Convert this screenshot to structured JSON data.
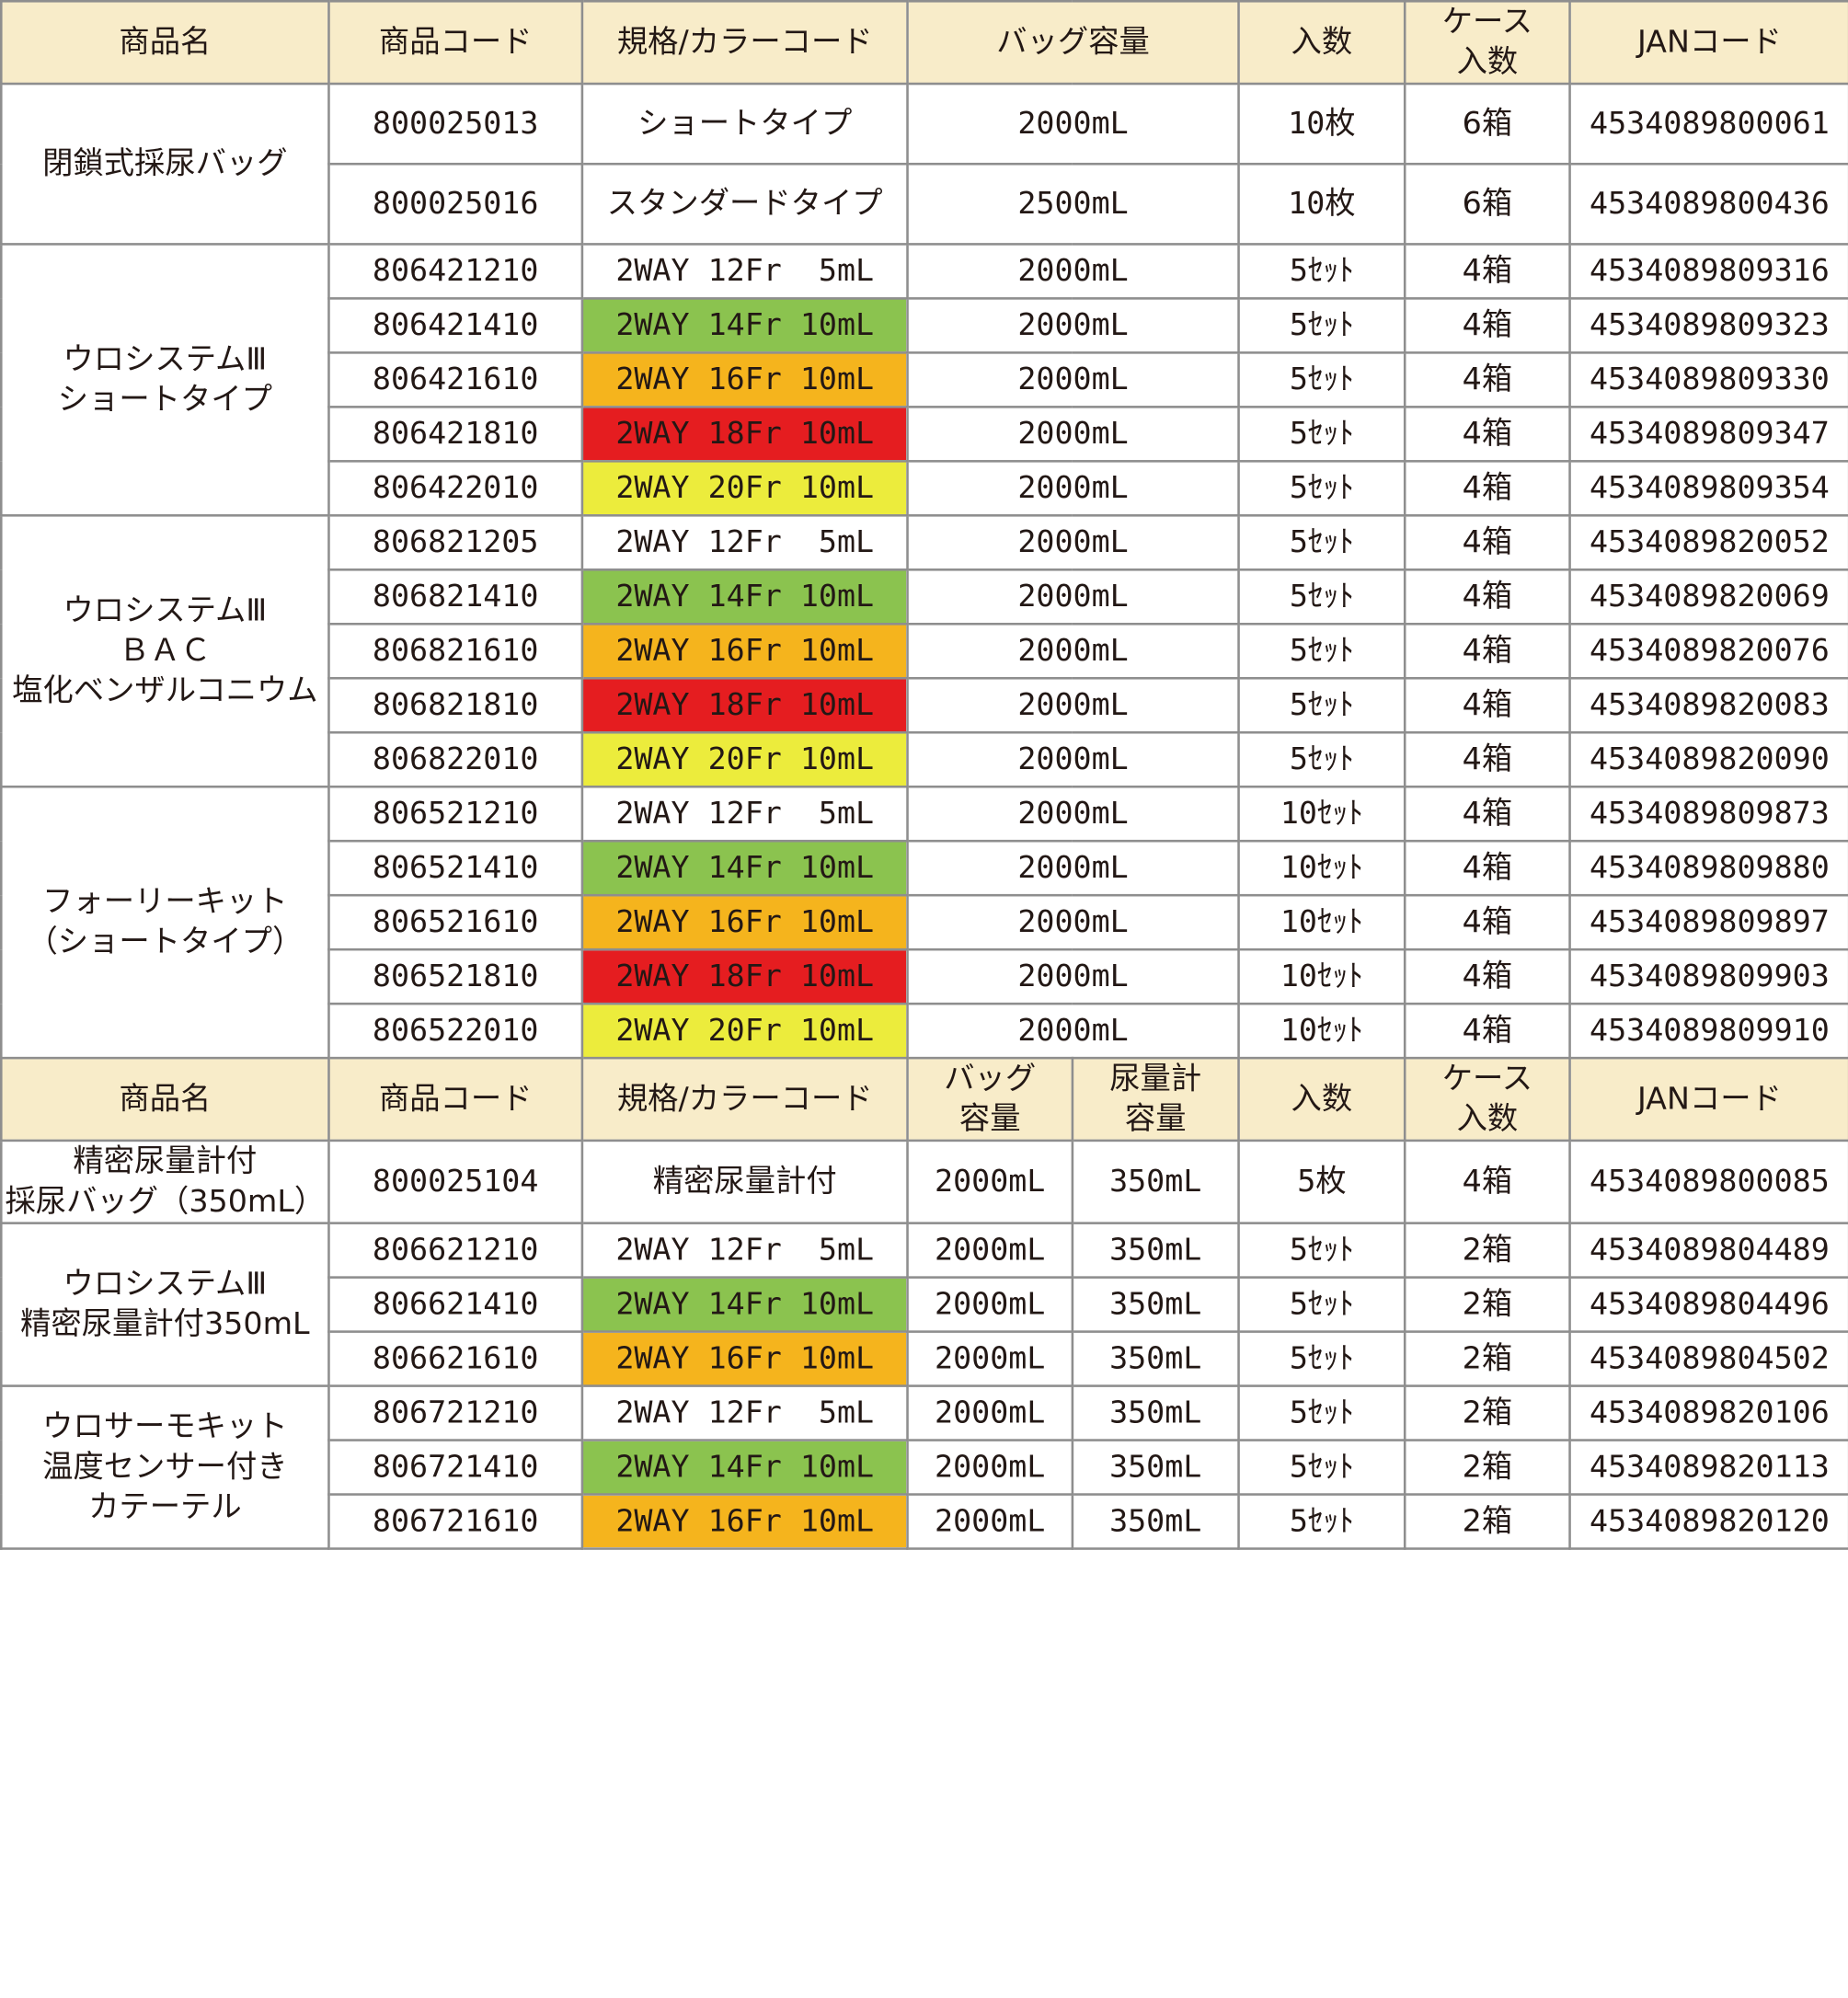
{
  "header1": {
    "name": "商品名",
    "code": "商品コード",
    "spec": "規格/カラーコード",
    "capacity": "バッグ容量",
    "qty": "入数",
    "case_line1": "ケース",
    "case_line2": "入数",
    "jan": "JANコード"
  },
  "header2": {
    "name": "商品名",
    "code": "商品コード",
    "spec": "規格/カラーコード",
    "bag_line1": "バッグ",
    "bag_line2": "容量",
    "meter_line1": "尿量計",
    "meter_line2": "容量",
    "qty": "入数",
    "case_line1": "ケース",
    "case_line2": "入数",
    "jan": "JANコード"
  },
  "colors": {
    "header_bg": "#f8ecc9",
    "14Fr": "#8bc34f",
    "16Fr": "#f5b41d",
    "18Fr": "#e51d20",
    "20Fr": "#ecec3c"
  },
  "groups": [
    {
      "name_lines": [
        "閉鎖式採尿バッグ"
      ],
      "rows": [
        {
          "code": "800025013",
          "spec": "ショートタイプ",
          "capacity": "2000mL",
          "qty": "10枚",
          "case": "6箱",
          "jan": "4534089800061"
        },
        {
          "code": "800025016",
          "spec": "スタンダードタイプ",
          "capacity": "2500mL",
          "qty": "10枚",
          "case": "6箱",
          "jan": "4534089800436"
        }
      ]
    },
    {
      "name_lines": [
        "ウロシステムⅢ",
        "ショートタイプ"
      ],
      "rows": [
        {
          "code": "806421210",
          "spec": "2WAY 12Fr  5mL",
          "capacity": "2000mL",
          "qty": "5ｾｯﾄ",
          "case": "4箱",
          "jan": "4534089809316"
        },
        {
          "code": "806421410",
          "spec": "2WAY 14Fr 10mL",
          "capacity": "2000mL",
          "qty": "5ｾｯﾄ",
          "case": "4箱",
          "jan": "4534089809323"
        },
        {
          "code": "806421610",
          "spec": "2WAY 16Fr 10mL",
          "capacity": "2000mL",
          "qty": "5ｾｯﾄ",
          "case": "4箱",
          "jan": "4534089809330"
        },
        {
          "code": "806421810",
          "spec": "2WAY 18Fr 10mL",
          "capacity": "2000mL",
          "qty": "5ｾｯﾄ",
          "case": "4箱",
          "jan": "4534089809347"
        },
        {
          "code": "806422010",
          "spec": "2WAY 20Fr 10mL",
          "capacity": "2000mL",
          "qty": "5ｾｯﾄ",
          "case": "4箱",
          "jan": "4534089809354"
        }
      ]
    },
    {
      "name_lines": [
        "ウロシステムⅢ",
        "ＢＡＣ",
        "塩化ベンザルコニウム"
      ],
      "rows": [
        {
          "code": "806821205",
          "spec": "2WAY 12Fr  5mL",
          "capacity": "2000mL",
          "qty": "5ｾｯﾄ",
          "case": "4箱",
          "jan": "4534089820052"
        },
        {
          "code": "806821410",
          "spec": "2WAY 14Fr 10mL",
          "capacity": "2000mL",
          "qty": "5ｾｯﾄ",
          "case": "4箱",
          "jan": "4534089820069"
        },
        {
          "code": "806821610",
          "spec": "2WAY 16Fr 10mL",
          "capacity": "2000mL",
          "qty": "5ｾｯﾄ",
          "case": "4箱",
          "jan": "4534089820076"
        },
        {
          "code": "806821810",
          "spec": "2WAY 18Fr 10mL",
          "capacity": "2000mL",
          "qty": "5ｾｯﾄ",
          "case": "4箱",
          "jan": "4534089820083"
        },
        {
          "code": "806822010",
          "spec": "2WAY 20Fr 10mL",
          "capacity": "2000mL",
          "qty": "5ｾｯﾄ",
          "case": "4箱",
          "jan": "4534089820090"
        }
      ]
    },
    {
      "name_lines": [
        "フォーリーキット",
        "（ショートタイプ）"
      ],
      "rows": [
        {
          "code": "806521210",
          "spec": "2WAY 12Fr  5mL",
          "capacity": "2000mL",
          "qty": "10ｾｯﾄ",
          "case": "4箱",
          "jan": "4534089809873"
        },
        {
          "code": "806521410",
          "spec": "2WAY 14Fr 10mL",
          "capacity": "2000mL",
          "qty": "10ｾｯﾄ",
          "case": "4箱",
          "jan": "4534089809880"
        },
        {
          "code": "806521610",
          "spec": "2WAY 16Fr 10mL",
          "capacity": "2000mL",
          "qty": "10ｾｯﾄ",
          "case": "4箱",
          "jan": "4534089809897"
        },
        {
          "code": "806521810",
          "spec": "2WAY 18Fr 10mL",
          "capacity": "2000mL",
          "qty": "10ｾｯﾄ",
          "case": "4箱",
          "jan": "4534089809903"
        },
        {
          "code": "806522010",
          "spec": "2WAY 20Fr 10mL",
          "capacity": "2000mL",
          "qty": "10ｾｯﾄ",
          "case": "4箱",
          "jan": "4534089809910"
        }
      ]
    }
  ],
  "groups2": [
    {
      "name_lines": [
        "精密尿量計付",
        "採尿バッグ（350mL）"
      ],
      "rows": [
        {
          "code": "800025104",
          "spec": "精密尿量計付",
          "bag": "2000mL",
          "meter": "350mL",
          "qty": "5枚",
          "case": "4箱",
          "jan": "4534089800085"
        }
      ]
    },
    {
      "name_lines": [
        "ウロシステムⅢ",
        "精密尿量計付350mL"
      ],
      "rows": [
        {
          "code": "806621210",
          "spec": "2WAY 12Fr  5mL",
          "bag": "2000mL",
          "meter": "350mL",
          "qty": "5ｾｯﾄ",
          "case": "2箱",
          "jan": "4534089804489"
        },
        {
          "code": "806621410",
          "spec": "2WAY 14Fr 10mL",
          "bag": "2000mL",
          "meter": "350mL",
          "qty": "5ｾｯﾄ",
          "case": "2箱",
          "jan": "4534089804496"
        },
        {
          "code": "806621610",
          "spec": "2WAY 16Fr 10mL",
          "bag": "2000mL",
          "meter": "350mL",
          "qty": "5ｾｯﾄ",
          "case": "2箱",
          "jan": "4534089804502"
        }
      ]
    },
    {
      "name_lines": [
        "ウロサーモキット",
        "温度センサー付き",
        "カテーテル"
      ],
      "rows": [
        {
          "code": "806721210",
          "spec": "2WAY 12Fr  5mL",
          "bag": "2000mL",
          "meter": "350mL",
          "qty": "5ｾｯﾄ",
          "case": "2箱",
          "jan": "4534089820106"
        },
        {
          "code": "806721410",
          "spec": "2WAY 14Fr 10mL",
          "bag": "2000mL",
          "meter": "350mL",
          "qty": "5ｾｯﾄ",
          "case": "2箱",
          "jan": "4534089820113"
        },
        {
          "code": "806721610",
          "spec": "2WAY 16Fr 10mL",
          "bag": "2000mL",
          "meter": "350mL",
          "qty": "5ｾｯﾄ",
          "case": "2箱",
          "jan": "4534089820120"
        }
      ]
    }
  ]
}
